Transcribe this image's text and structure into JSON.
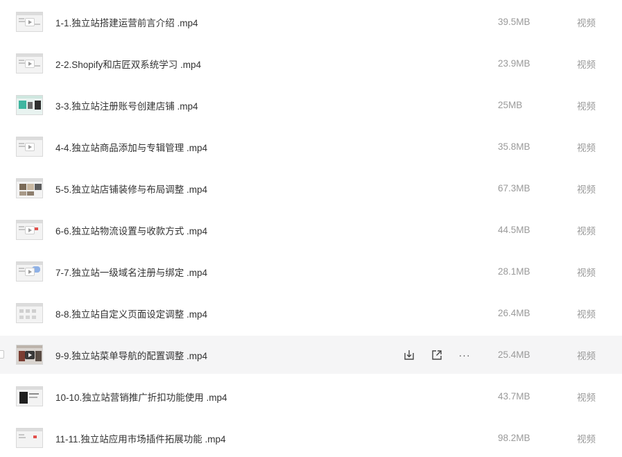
{
  "files": [
    {
      "name": "1-1.独立站搭建运营前言介绍 .mp4",
      "size": "39.5MB",
      "type": "视频",
      "thumb": "plain"
    },
    {
      "name": "2-2.Shopify和店匠双系统学习 .mp4",
      "size": "23.9MB",
      "type": "视频",
      "thumb": "plain"
    },
    {
      "name": "3-3.独立站注册账号创建店铺 .mp4",
      "size": "25MB",
      "type": "视频",
      "thumb": "green"
    },
    {
      "name": "4-4.独立站商品添加与专辑管理 .mp4",
      "size": "35.8MB",
      "type": "视频",
      "thumb": "plain"
    },
    {
      "name": "5-5.独立站店铺装修与布局调整 .mp4",
      "size": "67.3MB",
      "type": "视频",
      "thumb": "photo"
    },
    {
      "name": "6-6.独立站物流设置与收款方式 .mp4",
      "size": "44.5MB",
      "type": "视频",
      "thumb": "red"
    },
    {
      "name": "7-7.独立站一级域名注册与绑定 .mp4",
      "size": "28.1MB",
      "type": "视频",
      "thumb": "blue"
    },
    {
      "name": "8-8.独立站自定义页面设定调整 .mp4",
      "size": "26.4MB",
      "type": "视频",
      "thumb": "grid"
    },
    {
      "name": "9-9.独立站菜单导航的配置调整 .mp4",
      "size": "25.4MB",
      "type": "视频",
      "thumb": "dark",
      "hover": true
    },
    {
      "name": "10-10.独立站营销推广折扣功能使用 .mp4",
      "size": "43.7MB",
      "type": "视频",
      "thumb": "black"
    },
    {
      "name": "11-11.独立站应用市场插件拓展功能 .mp4",
      "size": "98.2MB",
      "type": "视频",
      "thumb": "plain"
    }
  ],
  "row_actions": {
    "download_icon": "download-icon",
    "share_icon": "share-icon",
    "more_label": "···"
  },
  "colors": {
    "row_hover_bg": "#f5f5f6",
    "text_primary": "#333333",
    "text_secondary": "#9a9a9a"
  }
}
